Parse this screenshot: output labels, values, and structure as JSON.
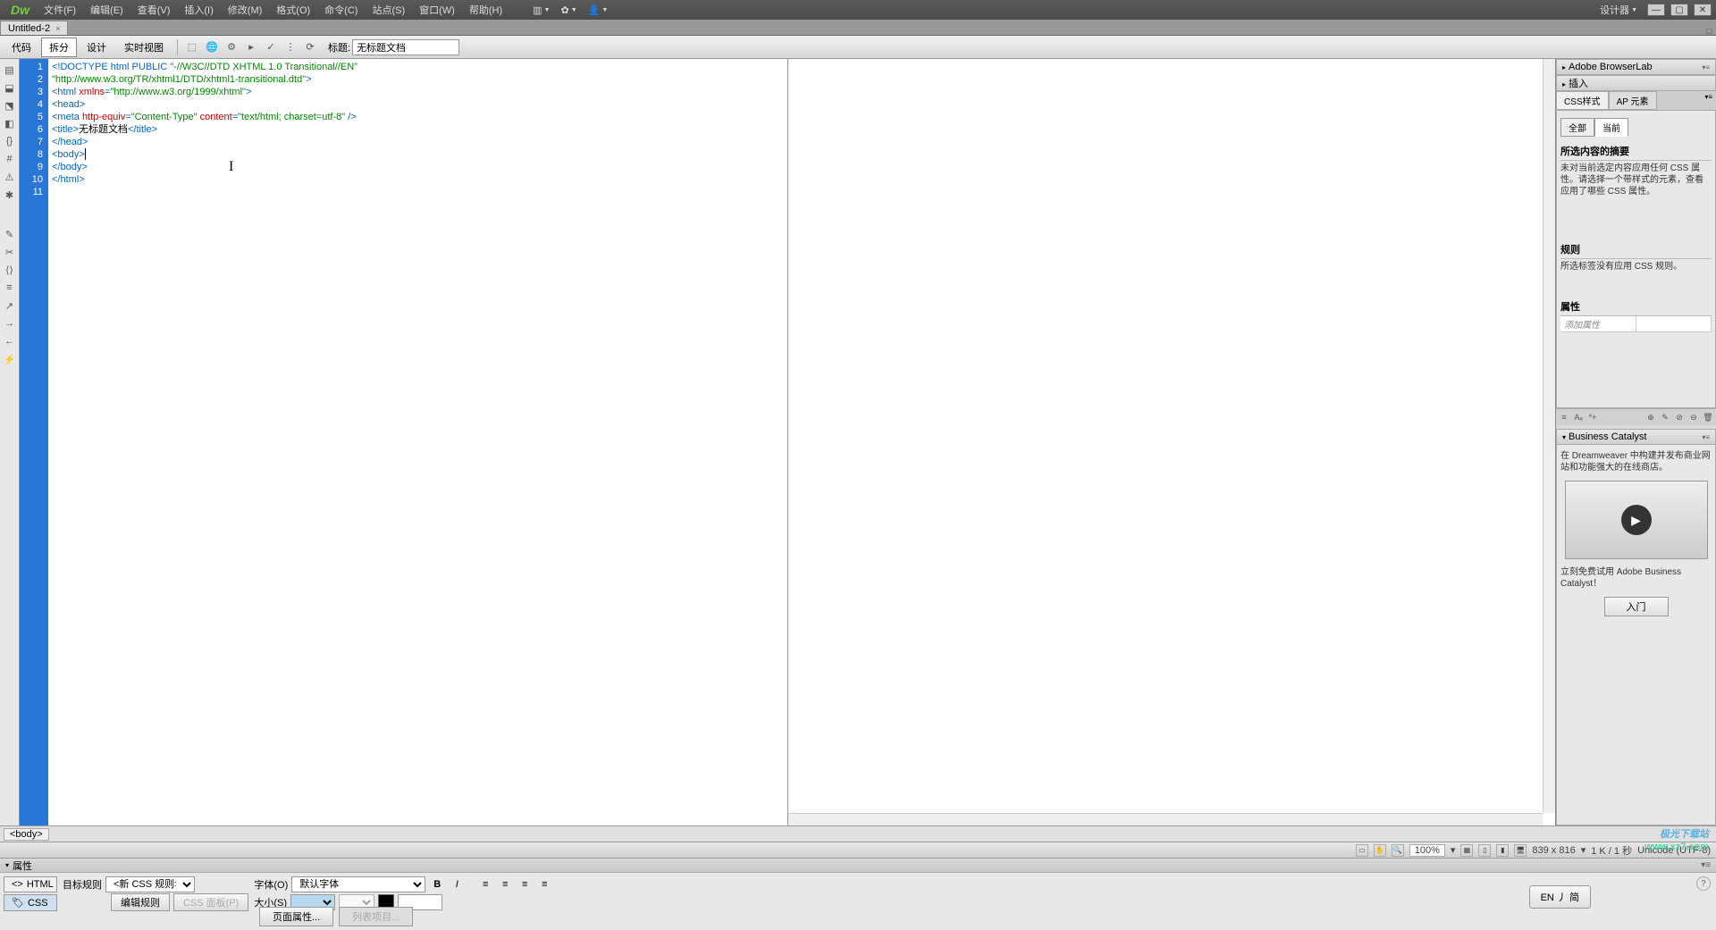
{
  "menubar": {
    "logo": "Dw",
    "items": [
      "文件(F)",
      "编辑(E)",
      "查看(V)",
      "插入(I)",
      "修改(M)",
      "格式(O)",
      "命令(C)",
      "站点(S)",
      "窗口(W)",
      "帮助(H)"
    ],
    "workspace": "设计器"
  },
  "tab": {
    "name": "Untitled-2",
    "close": "×"
  },
  "toolbar": {
    "views": [
      "代码",
      "拆分",
      "设计",
      "实时视图"
    ],
    "active_view_index": 1,
    "title_label": "标题:",
    "title_value": "无标题文档"
  },
  "code": {
    "lines": [
      {
        "n": 1,
        "html": "<span class='c-blue'>&lt;!DOCTYPE html PUBLIC </span><span class='c-green'>\"-//W3C//DTD XHTML 1.0 Transitional//EN\"</span>"
      },
      {
        "n": 2,
        "html": "<span class='c-green'>\"http://www.w3.org/TR/xhtml1/DTD/xhtml1-transitional.dtd\"</span><span class='c-blue'>&gt;</span>"
      },
      {
        "n": 3,
        "html": "<span class='c-blue'>&lt;html </span><span class='c-red'>xmlns</span><span class='c-blue'>=</span><span class='c-green'>\"http://www.w3.org/1999/xhtml\"</span><span class='c-blue'>&gt;</span>"
      },
      {
        "n": 4,
        "html": "<span class='c-blue'>&lt;head&gt;</span>"
      },
      {
        "n": 5,
        "html": "<span class='c-blue'>&lt;meta </span><span class='c-red'>http-equiv</span><span class='c-blue'>=</span><span class='c-green'>\"Content-Type\"</span> <span class='c-red'>content</span><span class='c-blue'>=</span><span class='c-green'>\"text/html; charset=utf-8\"</span> <span class='c-blue'>/&gt;</span>"
      },
      {
        "n": 6,
        "html": "<span class='c-blue'>&lt;title&gt;</span><span class='c-black'>无标题文档</span><span class='c-blue'>&lt;/title&gt;</span>"
      },
      {
        "n": 7,
        "html": "<span class='c-blue'>&lt;/head&gt;</span>"
      },
      {
        "n": 8,
        "html": ""
      },
      {
        "n": 9,
        "html": "<span class='c-blue'>&lt;body&gt;</span><span class='cursor-mark'></span>"
      },
      {
        "n": 10,
        "html": "<span class='c-blue'>&lt;/body&gt;</span>"
      },
      {
        "n": 11,
        "html": "<span class='c-blue'>&lt;/html&gt;</span>"
      }
    ],
    "line_numbers": [
      "1",
      "2",
      "3",
      "4",
      "5",
      "6",
      "7",
      "8",
      "9",
      "10",
      "11"
    ]
  },
  "tag_selector": {
    "path": "<body>"
  },
  "statusbar": {
    "zoom": "100%",
    "dims": "839 x 816",
    "size": "1 K / 1 秒",
    "encoding": "Unicode (UTF-8)"
  },
  "right": {
    "browserlab": "Adobe BrowserLab",
    "insert": "插入",
    "css_styles": "CSS样式",
    "ap_elements": "AP 元素",
    "all": "全部",
    "current": "当前",
    "summary_title": "所选内容的摘要",
    "summary_text": "未对当前选定内容应用任何 CSS 属性。请选择一个带样式的元素，查看应用了哪些 CSS 属性。",
    "rules_title": "规则",
    "rules_text": "所选标签没有应用 CSS 规则。",
    "props_title": "属性",
    "add_prop": "添加属性",
    "bc_title": "Business Catalyst",
    "bc_text1": "在 Dreamweaver 中构建并发布商业网站和功能强大的在线商店。",
    "bc_text2": "立刻免费试用 Adobe Business Catalyst！",
    "bc_btn": "入门"
  },
  "props": {
    "title": "属性",
    "html_mode": "HTML",
    "css_mode": "CSS",
    "target_rule": "目标规则",
    "new_rule": "<新 CSS 规则>",
    "edit_rule": "编辑规则",
    "css_panel": "CSS 面板(P)",
    "font": "字体(O)",
    "default_font": "默认字体",
    "size": "大小(S)",
    "page_props": "页面属性...",
    "list_items": "列表项目...",
    "en_toggle": "EN 丿 简"
  },
  "watermark": {
    "line1": "极光下载站",
    "line2": "www.xz7.com"
  }
}
